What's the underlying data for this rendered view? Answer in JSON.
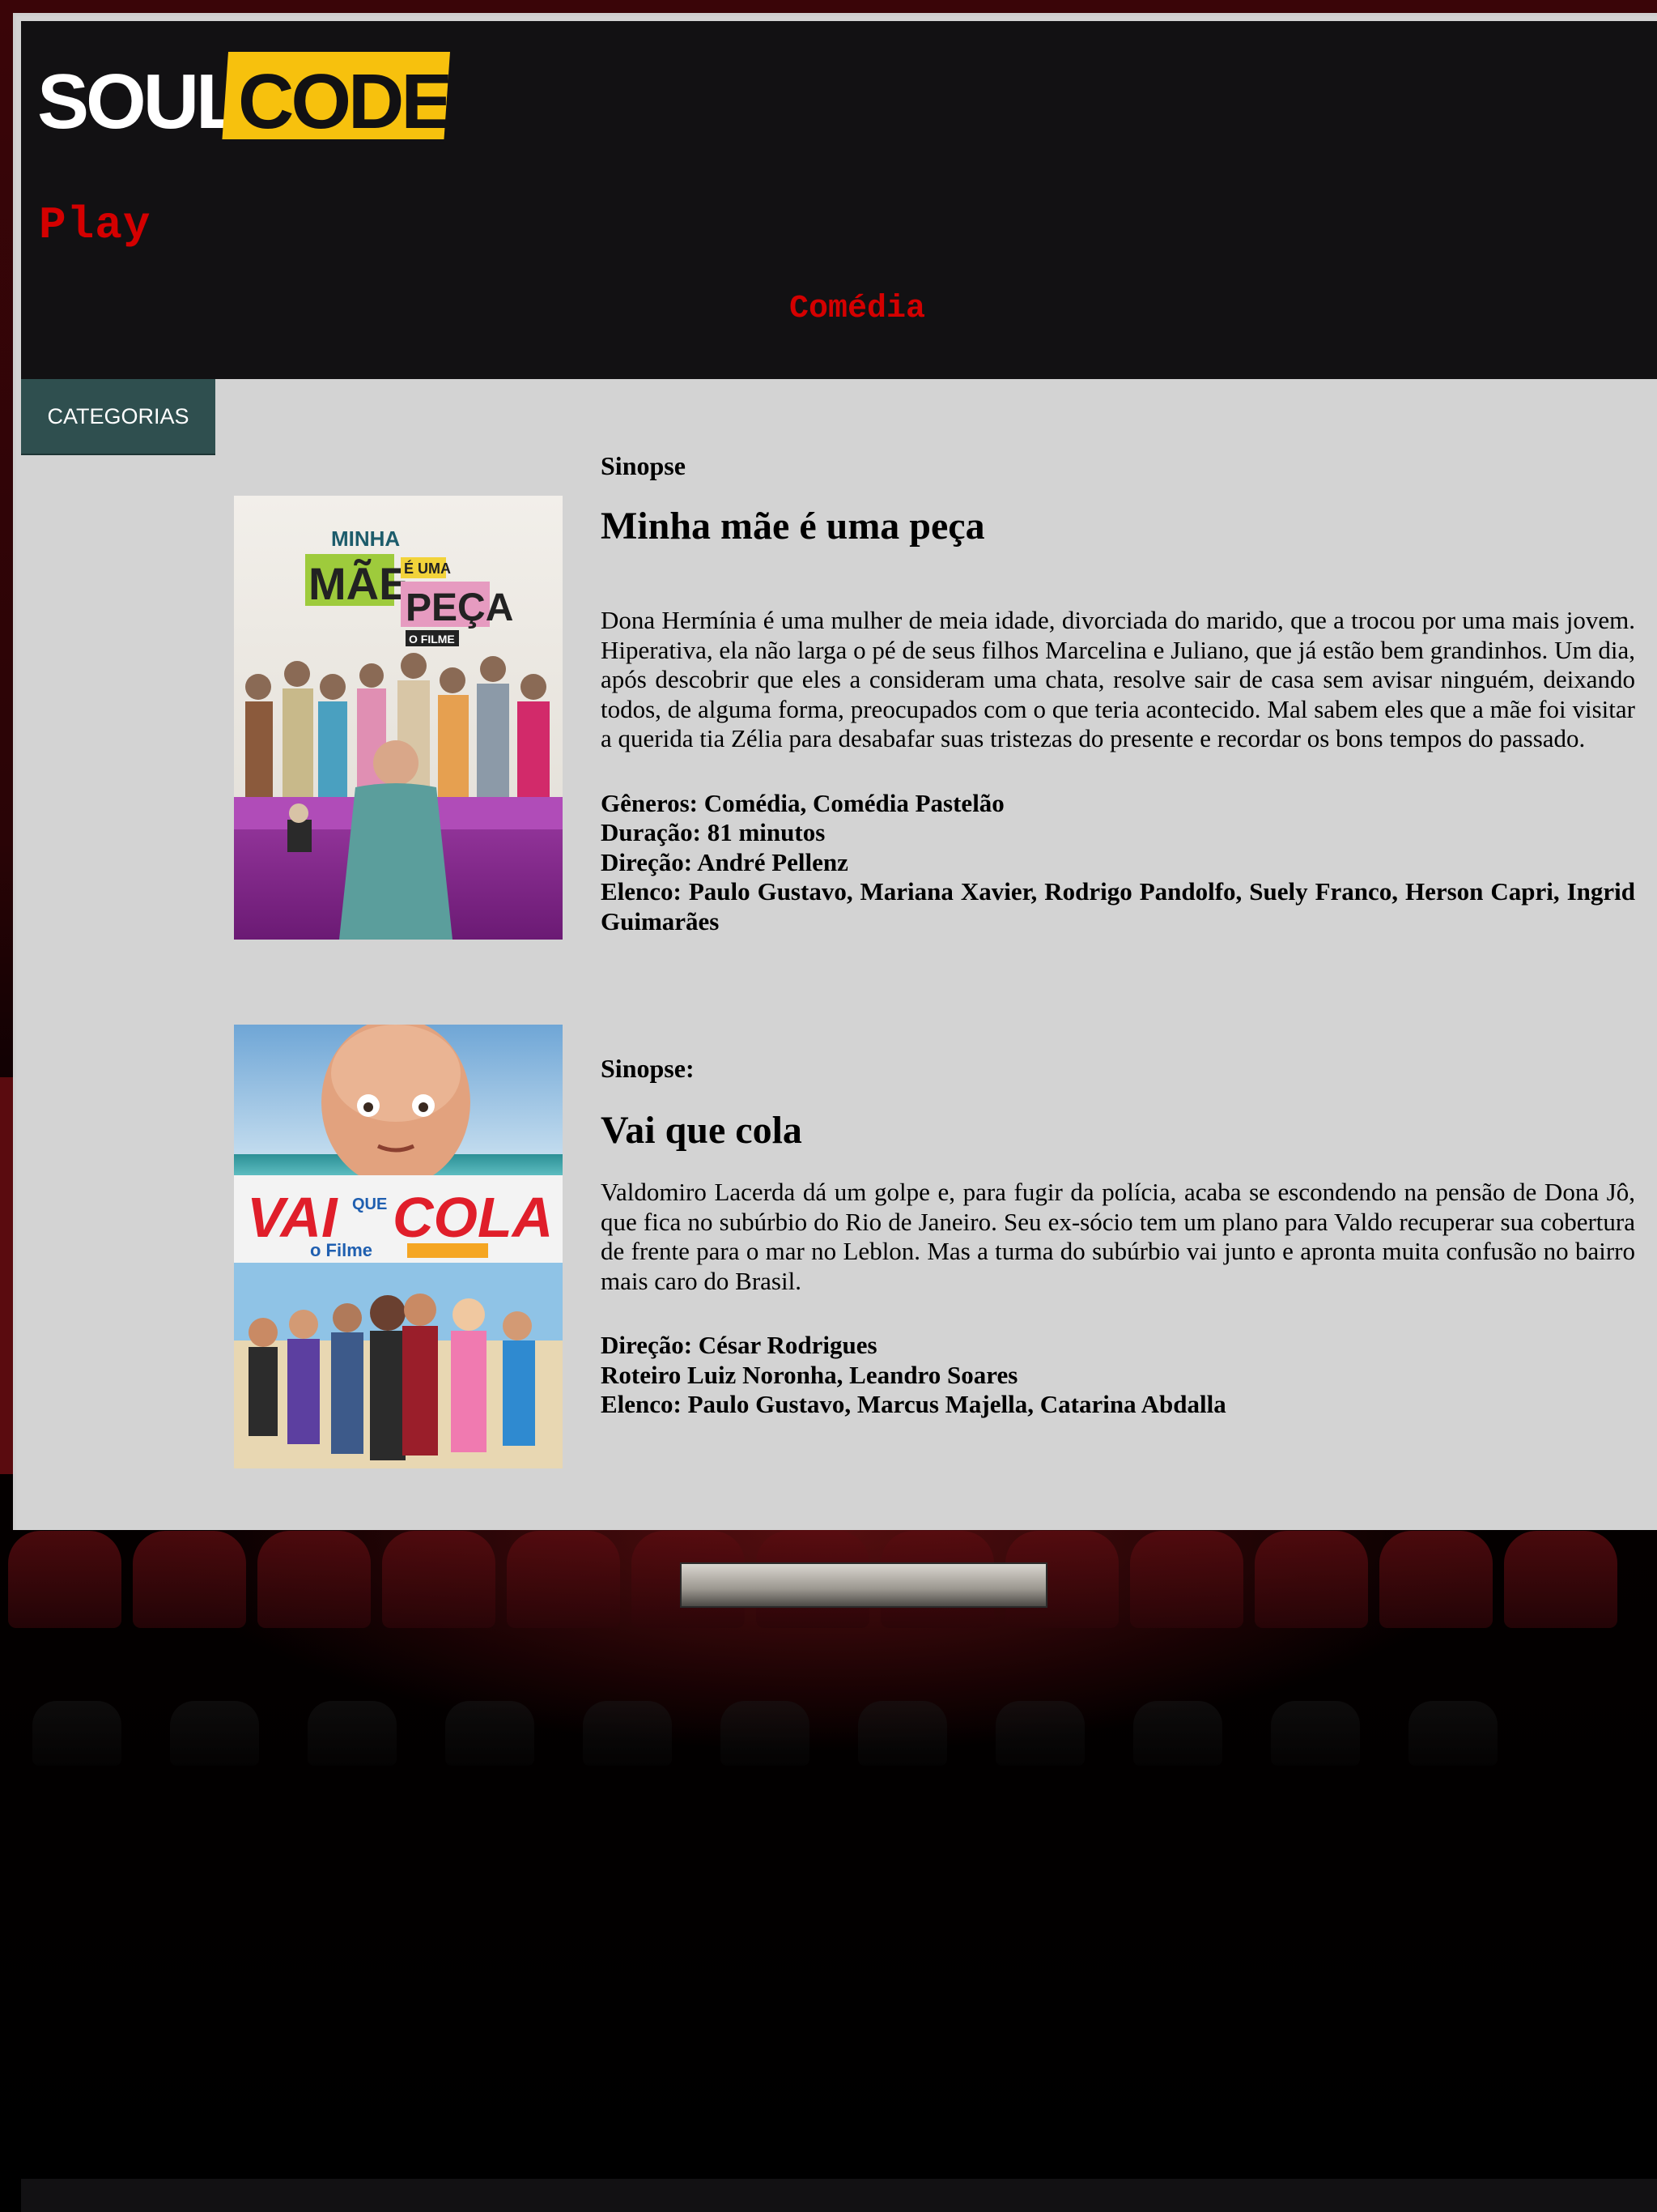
{
  "header": {
    "logo_soul": "SOUL",
    "logo_code": "CODE",
    "brand_text": "Play",
    "genre_heading": "Comédia"
  },
  "nav": {
    "categories_button": "CATEGORIAS"
  },
  "movies": [
    {
      "sinopse_label": "Sinopse",
      "title": "Minha mãe é uma peça",
      "synopsis": "Dona Hermínia é uma mulher de meia idade, divorciada do marido, que a trocou por uma mais jovem. Hiperativa, ela não larga o pé de seus filhos Marcelina e Juliano, que já estão bem grandinhos. Um dia, após descobrir que eles a consideram uma chata, resolve sair de casa sem avisar ninguém, deixando todos, de alguma forma, preocupados com o que teria acontecido. Mal sabem eles que a mãe foi visitar a querida tia Zélia para desabafar suas tristezas do presente e recordar os bons tempos do passado.",
      "details": [
        "Gêneros: Comédia, Comédia Pastelão",
        "Duração: 81 minutos",
        "Direção: André Pellenz",
        "Elenco: Paulo Gustavo, Mariana Xavier, Rodrigo Pandolfo, Suely Franco, Herson Capri, Ingrid Guimarães"
      ],
      "poster_text": [
        "MINHA",
        "MÃE",
        "É UMA",
        "PEÇA",
        "O FILME"
      ]
    },
    {
      "sinopse_label": "Sinopse:",
      "title": "Vai que cola",
      "synopsis": "Valdomiro Lacerda dá um golpe e, para fugir da polícia, acaba se escondendo na pensão de Dona Jô, que fica no subúrbio do Rio de Janeiro. Seu ex-sócio tem um plano para Valdo recuperar sua cobertura de frente para o mar no Leblon. Mas a turma do subúrbio vai junto e apronta muita confusão no bairro mais caro do Brasil.",
      "details": [
        "Direção: César Rodrigues",
        "Roteiro Luiz Noronha, Leandro Soares",
        "Elenco: Paulo Gustavo, Marcus Majella, Catarina Abdalla"
      ],
      "poster_text": [
        "VAI",
        "QUE",
        "COLA",
        "o Filme"
      ]
    }
  ],
  "colors": {
    "header_bg": "#121113",
    "content_bg": "#d3d3d3",
    "accent_red": "#d40000",
    "button_bg": "#2f4f4f",
    "logo_yellow": "#f7c10d"
  }
}
